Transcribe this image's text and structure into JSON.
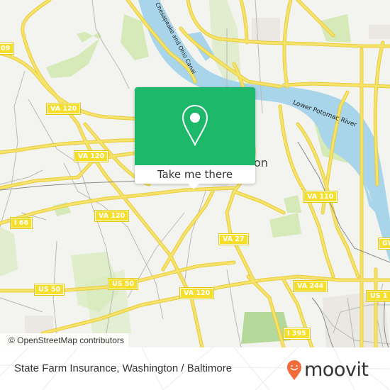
{
  "map": {
    "colors": {
      "land": "#f3f3ef",
      "water": "#a8d5ea",
      "park": "#d6e9b8",
      "road_major": "#f6e36b",
      "road_major_casing": "#e8cc3a",
      "road_minor": "#b9b9b5",
      "urban": "#e8e3e0",
      "shield_bg": "#f5df2a",
      "popup_green": "#1db86a",
      "moovit_orange": "#f26b3a"
    },
    "route_labels": [
      {
        "id": "us-29",
        "text": "09"
      },
      {
        "id": "va-120-north",
        "text": "VA 120"
      },
      {
        "id": "va-120-mid",
        "text": "VA 120"
      },
      {
        "id": "va-120-south-west",
        "text": "VA 120"
      },
      {
        "id": "i-66",
        "text": "I 66"
      },
      {
        "id": "va-110",
        "text": "VA 110"
      },
      {
        "id": "va-27",
        "text": "VA 27"
      },
      {
        "id": "gw",
        "text": "GW"
      },
      {
        "id": "us-50-west",
        "text": "US 50"
      },
      {
        "id": "us-50-east",
        "text": "US 50"
      },
      {
        "id": "va-120-south",
        "text": "VA 120"
      },
      {
        "id": "va-244",
        "text": "VA 244"
      },
      {
        "id": "us-1",
        "text": "US 1"
      },
      {
        "id": "i-395",
        "text": "I 395"
      }
    ],
    "water_labels": {
      "potomac": "Lower Potomac River",
      "canal": "Chesapeake and Ohio Canal"
    },
    "place_labels": {
      "arlington_partial": "on"
    },
    "attribution": "© OpenStreetMap contributors"
  },
  "popup": {
    "icon": "map-pin-icon",
    "action_label": "Take me there"
  },
  "footer": {
    "title": "State Farm Insurance, Washington / Baltimore",
    "brand": "moovit",
    "brand_icon": "moovit-smiley-pin-icon"
  }
}
